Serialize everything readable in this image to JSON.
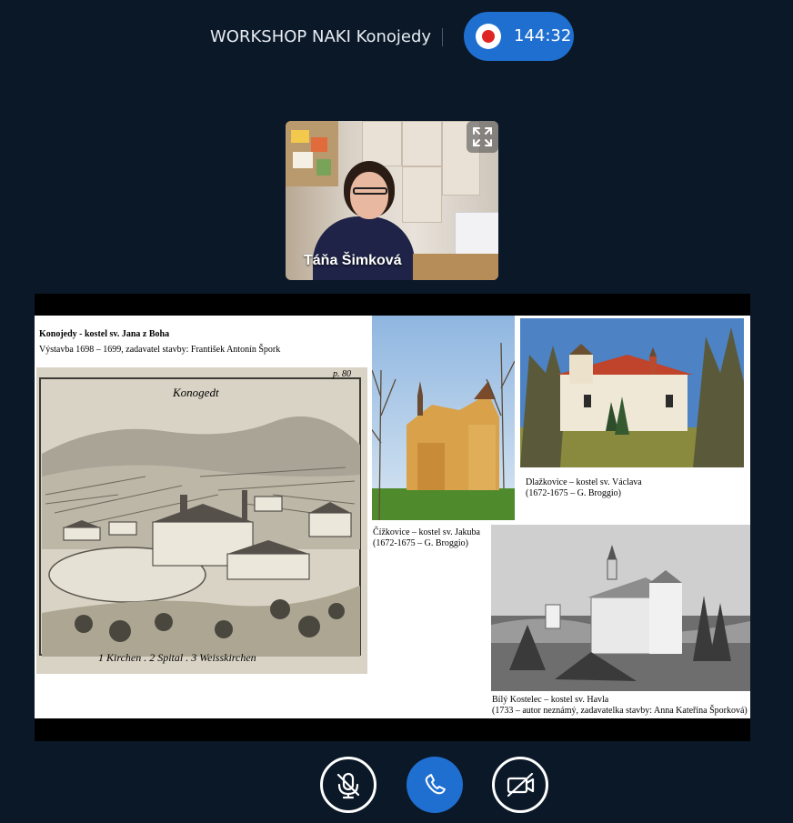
{
  "meeting": {
    "title": "WORKSHOP NAKI Konojedy",
    "recording_time": "144:32"
  },
  "presenter": {
    "name": "Táňa Šimková"
  },
  "slide": {
    "title": "Konojedy - kostel sv. Jana z Boha",
    "subtitle": "Výstavba 1698 – 1699, zadavatel stavby: František Antonín Špork",
    "engraving_caption": "1 Kirchen . 2 Spital . 3 Weisskirchen",
    "engraving_header": "Konogedt",
    "engraving_page": "p. 80",
    "captions": {
      "cizkovice_line1": "Čížkovice – kostel sv. Jakuba",
      "cizkovice_line2": "(1672-1675 – G. Broggio)",
      "dlazkovice_line1": "Dlažkovice – kostel sv. Václava",
      "dlazkovice_line2": "(1672-1675 – G. Broggio)",
      "bily_line1": "Bílý Kostelec – kostel sv. Havla",
      "bily_line2": "(1733 – autor neznámý, zadavatelka stavby: Anna Kateřina Šporková)"
    }
  },
  "controls": {
    "mic": "muted",
    "call": "active",
    "camera": "off"
  },
  "colors": {
    "background": "#0b1828",
    "accent": "#1f6fd1",
    "record": "#e02525"
  }
}
